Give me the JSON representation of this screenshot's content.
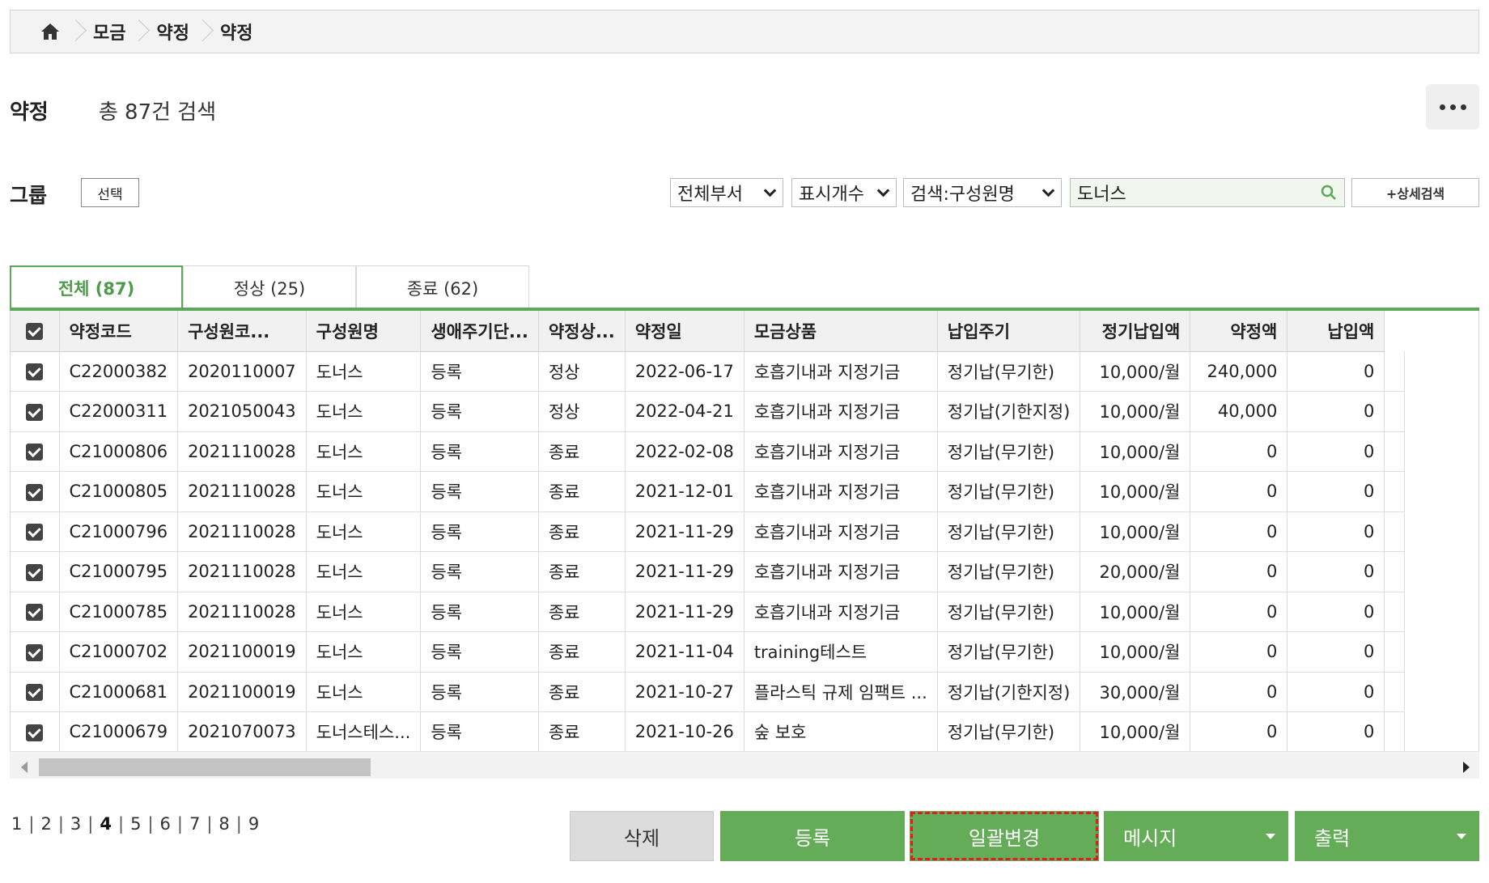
{
  "breadcrumb": {
    "home_icon": "home-icon",
    "items": [
      "모금",
      "약정",
      "약정"
    ]
  },
  "header": {
    "title": "약정",
    "count_text": "총 87건 검색",
    "more_icon": "more-horizontal-icon"
  },
  "filters": {
    "group_label": "그룹",
    "group_button": "선택",
    "department_select": "전체부서",
    "display_count_select": "표시개수",
    "search_type_select": "검색:구성원명",
    "search_value": "도너스",
    "advanced_search_button": "+상세검색"
  },
  "tabs": [
    {
      "label": "전체 (87)",
      "active": true
    },
    {
      "label": "정상 (25)",
      "active": false
    },
    {
      "label": "종료 (62)",
      "active": false
    }
  ],
  "table": {
    "columns": [
      "약정코드",
      "구성원코...",
      "구성원명",
      "생애주기단...",
      "약정상...",
      "약정일",
      "모금상품",
      "납입주기",
      "정기납입액",
      "약정액",
      "납입액"
    ],
    "rows": [
      {
        "checked": true,
        "code": "C22000382",
        "member_code": "2020110007",
        "member_name": "도너스",
        "lifecycle": "등록",
        "status": "정상",
        "date": "2022-06-17",
        "product": "호흡기내과 지정기금",
        "cycle": "정기납(무기한)",
        "regular_amount": "10,000/월",
        "pledge_amount": "240,000",
        "paid_amount": "0"
      },
      {
        "checked": true,
        "code": "C22000311",
        "member_code": "2021050043",
        "member_name": "도너스",
        "lifecycle": "등록",
        "status": "정상",
        "date": "2022-04-21",
        "product": "호흡기내과 지정기금",
        "cycle": "정기납(기한지정)",
        "regular_amount": "10,000/월",
        "pledge_amount": "40,000",
        "paid_amount": "0"
      },
      {
        "checked": true,
        "code": "C21000806",
        "member_code": "2021110028",
        "member_name": "도너스",
        "lifecycle": "등록",
        "status": "종료",
        "date": "2022-02-08",
        "product": "호흡기내과 지정기금",
        "cycle": "정기납(무기한)",
        "regular_amount": "10,000/월",
        "pledge_amount": "0",
        "paid_amount": "0"
      },
      {
        "checked": true,
        "code": "C21000805",
        "member_code": "2021110028",
        "member_name": "도너스",
        "lifecycle": "등록",
        "status": "종료",
        "date": "2021-12-01",
        "product": "호흡기내과 지정기금",
        "cycle": "정기납(무기한)",
        "regular_amount": "10,000/월",
        "pledge_amount": "0",
        "paid_amount": "0"
      },
      {
        "checked": true,
        "code": "C21000796",
        "member_code": "2021110028",
        "member_name": "도너스",
        "lifecycle": "등록",
        "status": "종료",
        "date": "2021-11-29",
        "product": "호흡기내과 지정기금",
        "cycle": "정기납(무기한)",
        "regular_amount": "10,000/월",
        "pledge_amount": "0",
        "paid_amount": "0"
      },
      {
        "checked": true,
        "code": "C21000795",
        "member_code": "2021110028",
        "member_name": "도너스",
        "lifecycle": "등록",
        "status": "종료",
        "date": "2021-11-29",
        "product": "호흡기내과 지정기금",
        "cycle": "정기납(무기한)",
        "regular_amount": "20,000/월",
        "pledge_amount": "0",
        "paid_amount": "0"
      },
      {
        "checked": true,
        "code": "C21000785",
        "member_code": "2021110028",
        "member_name": "도너스",
        "lifecycle": "등록",
        "status": "종료",
        "date": "2021-11-29",
        "product": "호흡기내과 지정기금",
        "cycle": "정기납(무기한)",
        "regular_amount": "10,000/월",
        "pledge_amount": "0",
        "paid_amount": "0"
      },
      {
        "checked": true,
        "code": "C21000702",
        "member_code": "2021100019",
        "member_name": "도너스",
        "lifecycle": "등록",
        "status": "종료",
        "date": "2021-11-04",
        "product": "training테스트",
        "cycle": "정기납(무기한)",
        "regular_amount": "10,000/월",
        "pledge_amount": "0",
        "paid_amount": "0"
      },
      {
        "checked": true,
        "code": "C21000681",
        "member_code": "2021100019",
        "member_name": "도너스",
        "lifecycle": "등록",
        "status": "종료",
        "date": "2021-10-27",
        "product": "플라스틱 규제 임팩트 ...",
        "cycle": "정기납(기한지정)",
        "regular_amount": "30,000/월",
        "pledge_amount": "0",
        "paid_amount": "0"
      },
      {
        "checked": true,
        "code": "C21000679",
        "member_code": "2021070073",
        "member_name": "도너스테스...",
        "lifecycle": "등록",
        "status": "종료",
        "date": "2021-10-26",
        "product": "숲 보호",
        "cycle": "정기납(무기한)",
        "regular_amount": "10,000/월",
        "pledge_amount": "0",
        "paid_amount": "0"
      }
    ]
  },
  "pagination": {
    "pages": [
      "1",
      "2",
      "3",
      "4",
      "5",
      "6",
      "7",
      "8",
      "9"
    ],
    "current": "4"
  },
  "actions": {
    "delete": "삭제",
    "register": "등록",
    "bulk_change": "일괄변경",
    "message": "메시지",
    "print": "출력"
  },
  "colors": {
    "accent_green": "#64ac57",
    "tab_green": "#5da65a",
    "highlight_dashed": "#e21d1d"
  }
}
